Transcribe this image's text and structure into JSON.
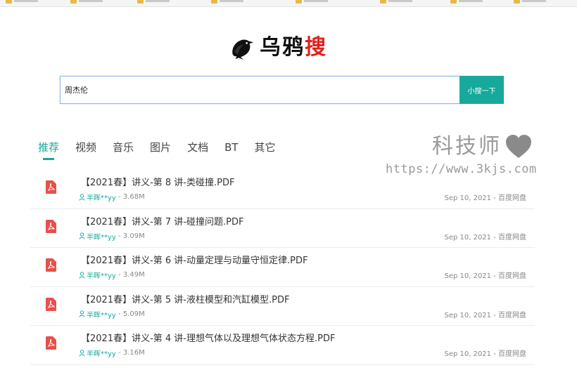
{
  "logo": {
    "text_main": "乌鸦",
    "text_accent": "搜"
  },
  "search": {
    "value": "周杰伦",
    "button_label": "小搜一下"
  },
  "tabs": [
    {
      "label": "推荐",
      "active": true
    },
    {
      "label": "视频"
    },
    {
      "label": "音乐"
    },
    {
      "label": "图片"
    },
    {
      "label": "文档"
    },
    {
      "label": "BT"
    },
    {
      "label": "其它"
    }
  ],
  "watermark": {
    "title": "科技师",
    "url": "https://www.3kjs.com"
  },
  "results": [
    {
      "title": "【2021春】讲义-第 8 讲-类碰撞.PDF",
      "user": "半晖**yy",
      "size": "3.68M",
      "date": "Sep 10, 2021",
      "source": "百度网盘"
    },
    {
      "title": "【2021春】讲义-第 7 讲-碰撞问题.PDF",
      "user": "半晖**yy",
      "size": "3.09M",
      "date": "Sep 10, 2021",
      "source": "百度网盘"
    },
    {
      "title": "【2021春】讲义-第 6 讲-动量定理与动量守恒定律.PDF",
      "user": "半晖**yy",
      "size": "3.49M",
      "date": "Sep 10, 2021",
      "source": "百度网盘"
    },
    {
      "title": "【2021春】讲义-第 5 讲-液柱模型和汽缸模型.PDF",
      "user": "半晖**yy",
      "size": "5.09M",
      "date": "Sep 10, 2021",
      "source": "百度网盘"
    },
    {
      "title": "【2021春】讲义-第 4 讲-理想气体以及理想气体状态方程.PDF",
      "user": "半晖**yy",
      "size": "3.16M",
      "date": "Sep 10, 2021",
      "source": "百度网盘"
    }
  ],
  "colors": {
    "accent": "#16a99c",
    "logo_accent": "#e0201c",
    "pdf_icon": "#e8504a"
  },
  "icons": {
    "file": "pdf-icon",
    "user": "user-icon",
    "logo": "crow-icon",
    "watermark": "heart-icon"
  }
}
